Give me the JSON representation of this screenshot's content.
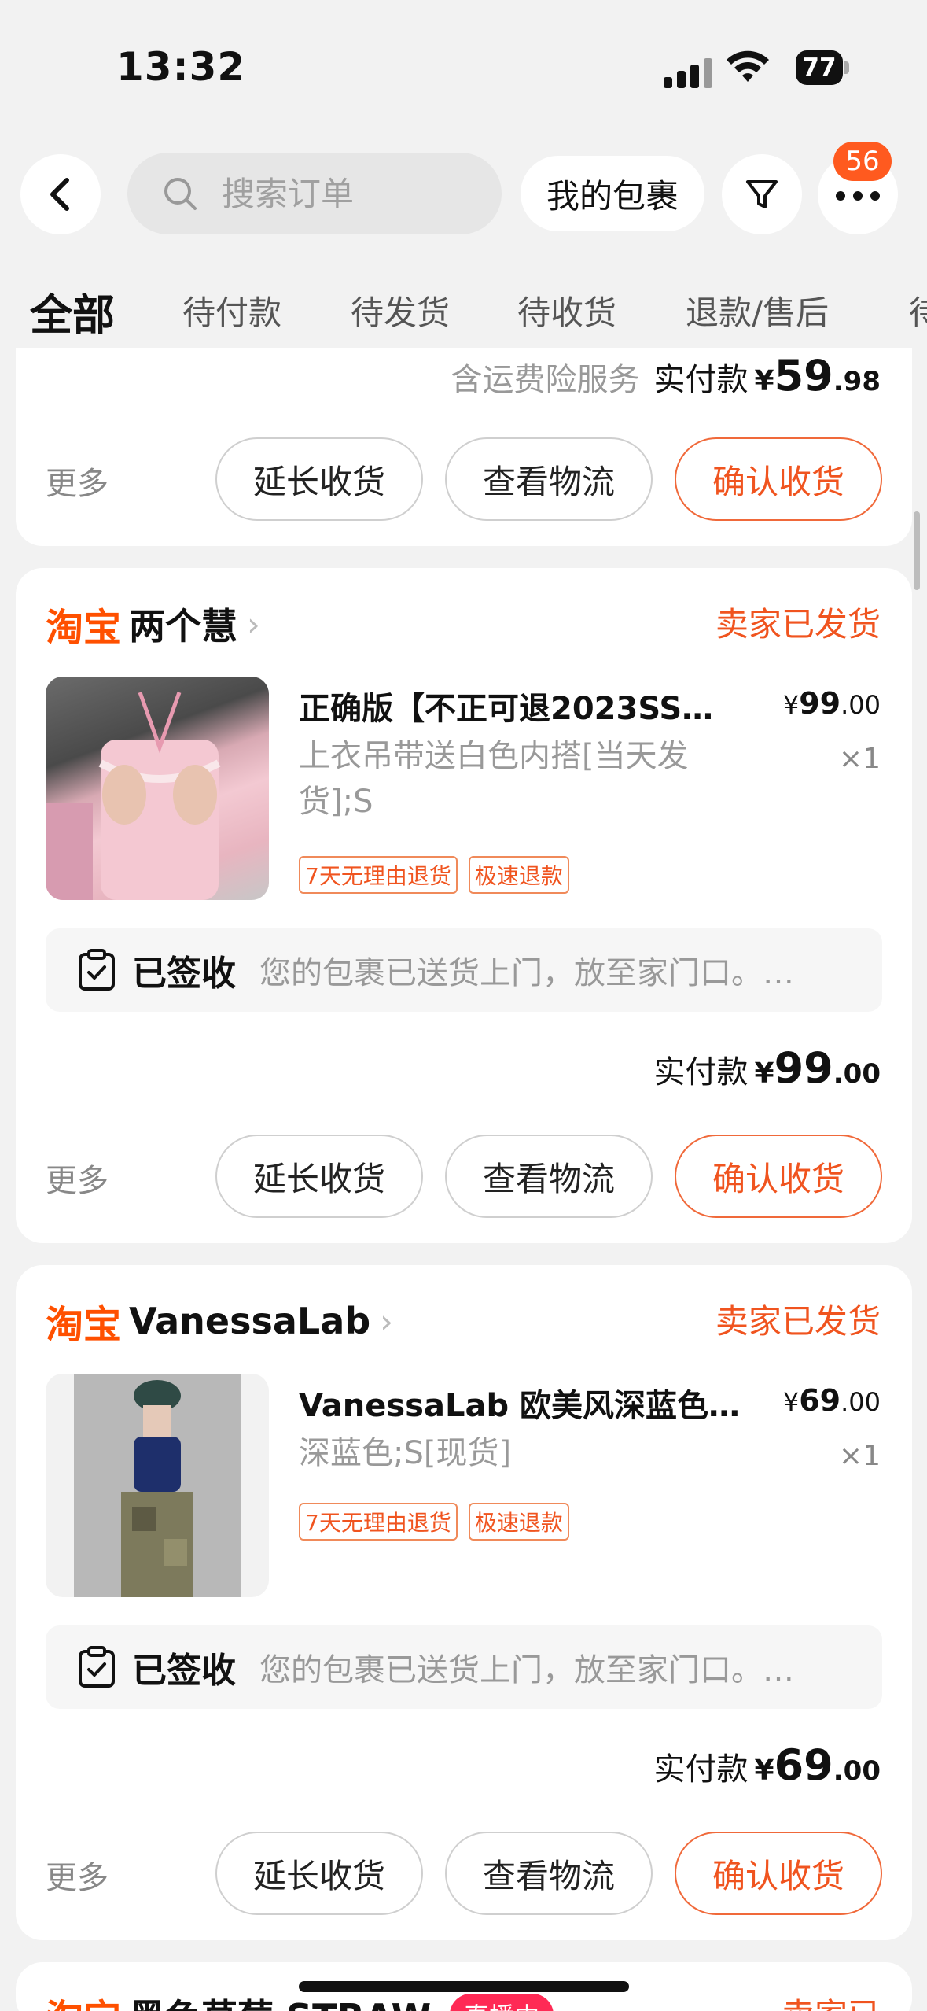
{
  "status_bar": {
    "time": "13:32",
    "battery": "77"
  },
  "header": {
    "search_placeholder": "搜索订单",
    "packages_label": "我的包裹",
    "badge_count": "56"
  },
  "tabs": [
    "全部",
    "待付款",
    "待发货",
    "待收货",
    "退款/售后",
    "待"
  ],
  "top_card": {
    "note": "含运费险服务",
    "pay_label": "实付款",
    "currency": "¥",
    "int": "59",
    "dec": ".98"
  },
  "buttons": {
    "more": "更多",
    "extend": "延长收货",
    "logistics": "查看物流",
    "confirm": "确认收货"
  },
  "orders": [
    {
      "platform": "淘宝",
      "shop": "两个慧",
      "status": "卖家已发货",
      "title": "正确版【不正可退2023SS…",
      "spec": "上衣吊带送白色内搭[当天发货];S",
      "price_int": "99",
      "price_dec": ".00",
      "qty": "×1",
      "tags": [
        "7天无理由退货",
        "极速退款"
      ],
      "logistics_title": "已签收",
      "logistics_desc": "您的包裹已送货上门，放至家门口。…",
      "pay_label": "实付款",
      "pay_int": "99",
      "pay_dec": ".00"
    },
    {
      "platform": "淘宝",
      "shop": "VanessaLab",
      "status": "卖家已发货",
      "title": "VanessaLab 欧美风深蓝色…",
      "spec": "深蓝色;S[现货]",
      "price_int": "69",
      "price_dec": ".00",
      "qty": "×1",
      "tags": [
        "7天无理由退货",
        "极速退款"
      ],
      "logistics_title": "已签收",
      "logistics_desc": "您的包裹已送货上门，放至家门口。…",
      "pay_label": "实付款",
      "pay_int": "69",
      "pay_dec": ".00"
    }
  ],
  "bottom_card": {
    "platform": "淘宝",
    "shop": "黑色草莓 STRAW",
    "live": "直播中",
    "status": "卖家已"
  },
  "colors": {
    "accent": "#f0541f",
    "taobao": "#ff5000",
    "badge": "#ff5a1f"
  }
}
